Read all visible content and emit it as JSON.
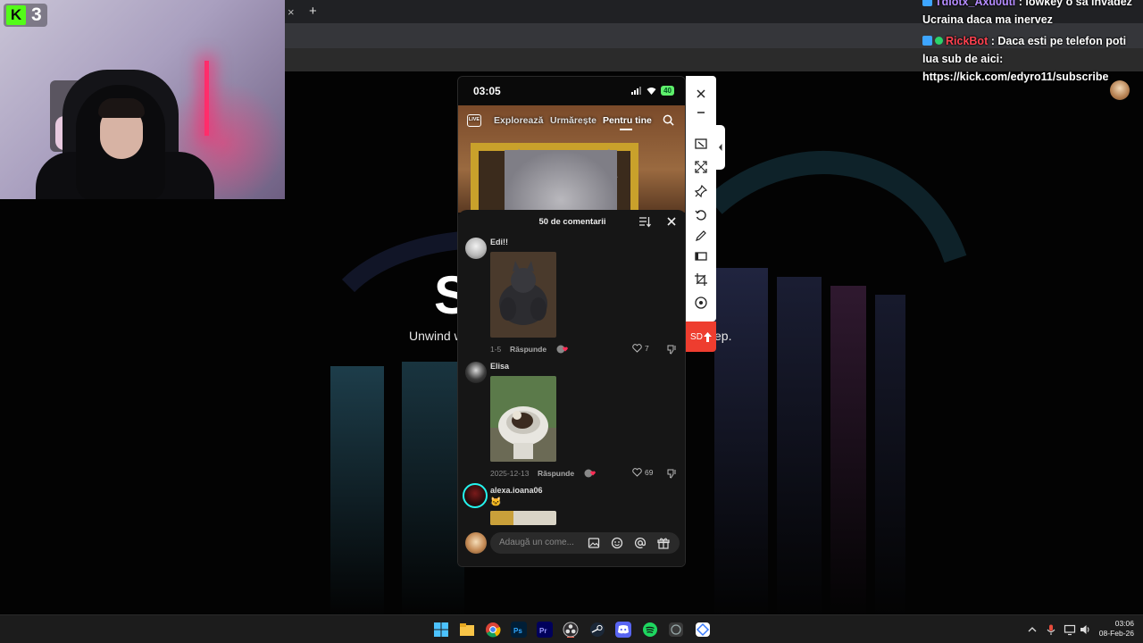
{
  "browser": {
    "tab_close": "×",
    "tab_new": "+"
  },
  "website": {
    "hero_letter": "S",
    "subtitle_left": "Unwind w",
    "subtitle_right": "ep."
  },
  "stream": {
    "viewer_count": "3",
    "platform_logo_letter": "K",
    "accent": "#53fc18"
  },
  "chat": {
    "messages": [
      {
        "user": "Tdiotx_Axu0uti",
        "sep": " : ",
        "text": "lowkey o să invadez",
        "continued": "Ucraina daca ma inervez"
      },
      {
        "user": "RickBot",
        "sep": " : ",
        "text": "Daca esti pe telefon poti",
        "continued": "lua sub de aici:",
        "continued2": "https://kick.com/edyro11/subscribe"
      }
    ]
  },
  "phone": {
    "time": "03:05",
    "battery": "40",
    "nav": {
      "explore": "Explorează",
      "following": "Urmărește",
      "for_you": "Pentru tine"
    },
    "comments": {
      "title": "50 de comentarii",
      "items": [
        {
          "user": "Edi!!",
          "date": "1-5",
          "reply": "Răspunde",
          "likes": "7"
        },
        {
          "user": "Elisa",
          "date": "2025-12-13",
          "reply": "Răspunde",
          "likes": "69"
        },
        {
          "user": "alexa.ioana06",
          "emoji": "🐱"
        }
      ],
      "input_placeholder": "Adaugă un come..."
    }
  },
  "tools": {
    "sd_label": "SD"
  },
  "taskbar": {
    "time": "03:06",
    "date": "08-Feb-26"
  }
}
